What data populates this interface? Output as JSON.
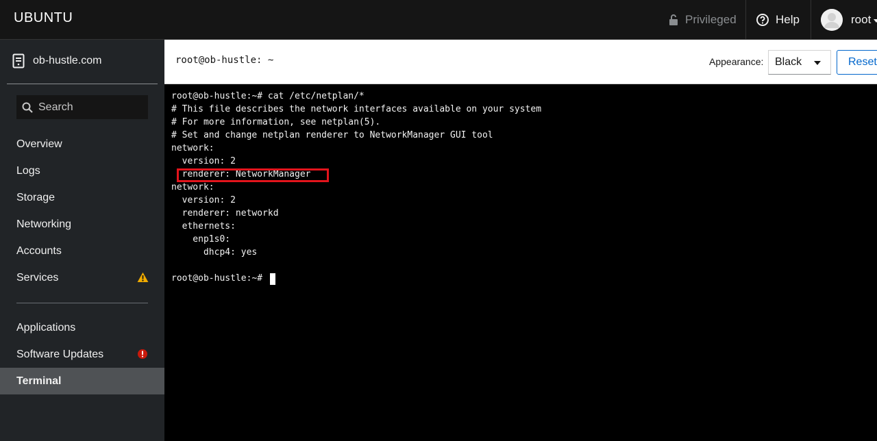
{
  "topbar": {
    "brand": "UBUNTU",
    "privileged_label": "Privileged",
    "help_label": "Help",
    "user_label": "root"
  },
  "sidebar": {
    "host": "ob-hustle.com",
    "search_placeholder": "Search",
    "items": [
      {
        "label": "Overview"
      },
      {
        "label": "Logs"
      },
      {
        "label": "Storage"
      },
      {
        "label": "Networking"
      },
      {
        "label": "Accounts"
      },
      {
        "label": "Services",
        "badge": "warning"
      },
      {
        "label": "Applications"
      },
      {
        "label": "Software Updates",
        "badge": "error"
      },
      {
        "label": "Terminal",
        "active": true
      }
    ]
  },
  "header": {
    "title": "root@ob-hustle: ~",
    "appearance_label": "Appearance:",
    "appearance_value": "Black",
    "reset_label": "Reset"
  },
  "terminal": {
    "lines": [
      "root@ob-hustle:~# cat /etc/netplan/*",
      "# This file describes the network interfaces available on your system",
      "# For more information, see netplan(5).",
      "# Set and change netplan renderer to NetworkManager GUI tool",
      "network:",
      "  version: 2",
      "  renderer: NetworkManager",
      "network:",
      "  version: 2",
      "  renderer: networkd",
      "  ethernets:",
      "    enp1s0:",
      "      dhcp4: yes",
      "",
      "root@ob-hustle:~# "
    ]
  },
  "colors": {
    "highlight": "#e3141c",
    "warning": "#f0ab00",
    "error": "#c9190b",
    "link": "#0066cc"
  }
}
